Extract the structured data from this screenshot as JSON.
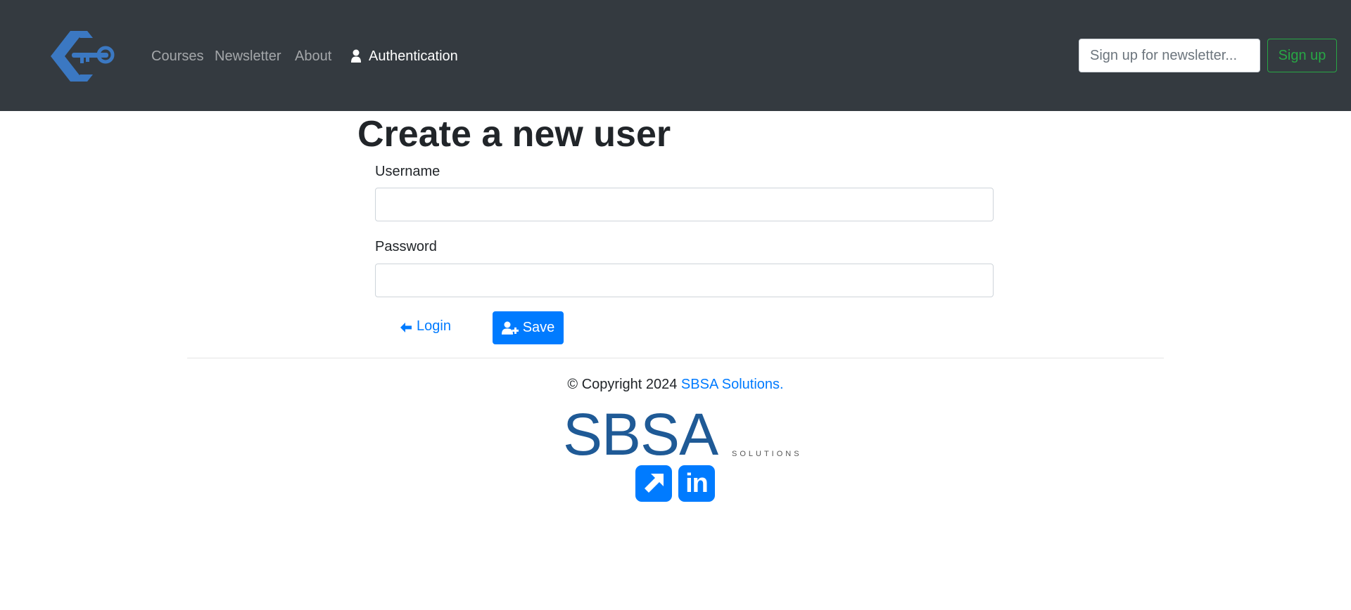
{
  "nav": {
    "items": [
      {
        "label": "Courses"
      },
      {
        "label": "Newsletter"
      },
      {
        "label": "About"
      },
      {
        "label": "Authentication"
      }
    ],
    "newsletter_placeholder": "Sign up for newsletter...",
    "signup_label": "Sign up"
  },
  "main": {
    "title": "Create a new user",
    "username_label": "Username",
    "username_value": "",
    "password_label": "Password",
    "password_value": "",
    "login_label": "Login",
    "save_label": "Save"
  },
  "footer": {
    "copyright_prefix": "© Copyright 2024 ",
    "company_link": "SBSA Solutions.",
    "logo_text": "SBSA",
    "logo_sub": "SOLUTIONS"
  },
  "colors": {
    "navbar_bg": "#343a40",
    "primary": "#007bff",
    "success": "#28a745",
    "logo_blue": "#1f5a96"
  },
  "icons": {
    "brand": "key-diamond-logo-icon",
    "auth": "user-icon",
    "login": "arrow-left-icon",
    "save": "user-plus-icon",
    "social_1": "external-link-icon",
    "social_2": "linkedin-icon"
  }
}
